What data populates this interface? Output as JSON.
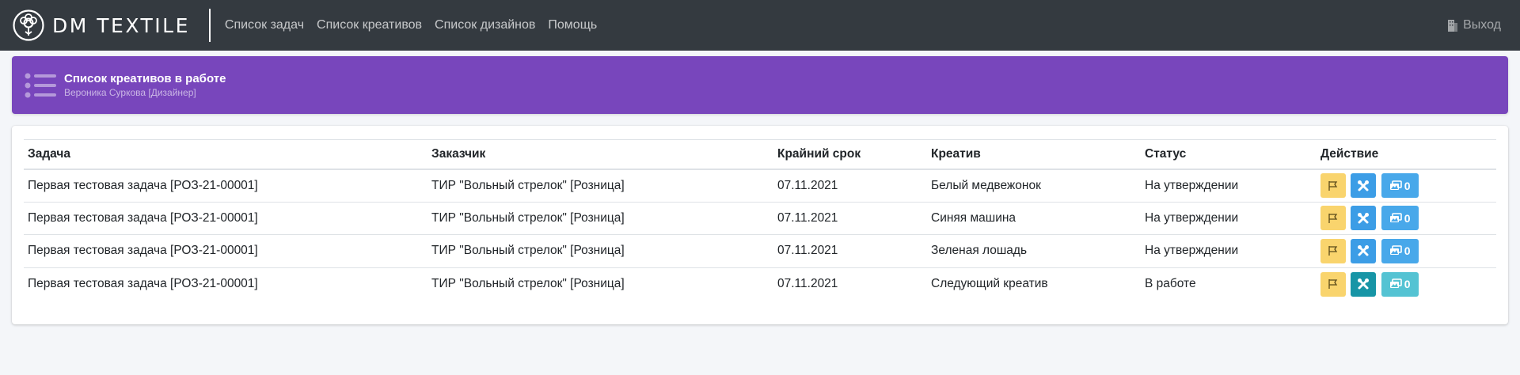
{
  "brand": {
    "name": "DM TEXTILE"
  },
  "nav": {
    "items": [
      "Список задач",
      "Список креативов",
      "Список дизайнов",
      "Помощь"
    ],
    "logout": "Выход"
  },
  "banner": {
    "title": "Список креативов в работе",
    "subtitle": "Вероника Суркова [Дизайнер]"
  },
  "table": {
    "headers": [
      "Задача",
      "Заказчик",
      "Крайний срок",
      "Креатив",
      "Статус",
      "Действие"
    ],
    "rows": [
      {
        "task": "Первая тестовая задача [РОЗ-21-00001]",
        "customer": "ТИР \"Вольный стрелок\" [Розница]",
        "deadline": "07.11.2021",
        "creative": "Белый медвежонок",
        "status": "На утверждении",
        "count": "0"
      },
      {
        "task": "Первая тестовая задача [РОЗ-21-00001]",
        "customer": "ТИР \"Вольный стрелок\" [Розница]",
        "deadline": "07.11.2021",
        "creative": "Синяя машина",
        "status": "На утверждении",
        "count": "0"
      },
      {
        "task": "Первая тестовая задача [РОЗ-21-00001]",
        "customer": "ТИР \"Вольный стрелок\" [Розница]",
        "deadline": "07.11.2021",
        "creative": "Зеленая лошадь",
        "status": "На утверждении",
        "count": "0"
      },
      {
        "task": "Первая тестовая задача [РОЗ-21-00001]",
        "customer": "ТИР \"Вольный стрелок\" [Розница]",
        "deadline": "07.11.2021",
        "creative": "Следующий креатив",
        "status": "В работе",
        "count": "0"
      }
    ]
  },
  "colors": {
    "navbar": "#343a40",
    "banner": "#7846bc",
    "flag_button": "#f9d46d",
    "tools_button": "#3c9de6",
    "gallery_button": "#48a8ea"
  },
  "icons": {
    "logo": "cotton-flower-icon",
    "logout": "building-exit-icon",
    "banner": "list-icon",
    "flag": "flag-icon",
    "tools": "tools-icon",
    "gallery": "images-icon"
  }
}
